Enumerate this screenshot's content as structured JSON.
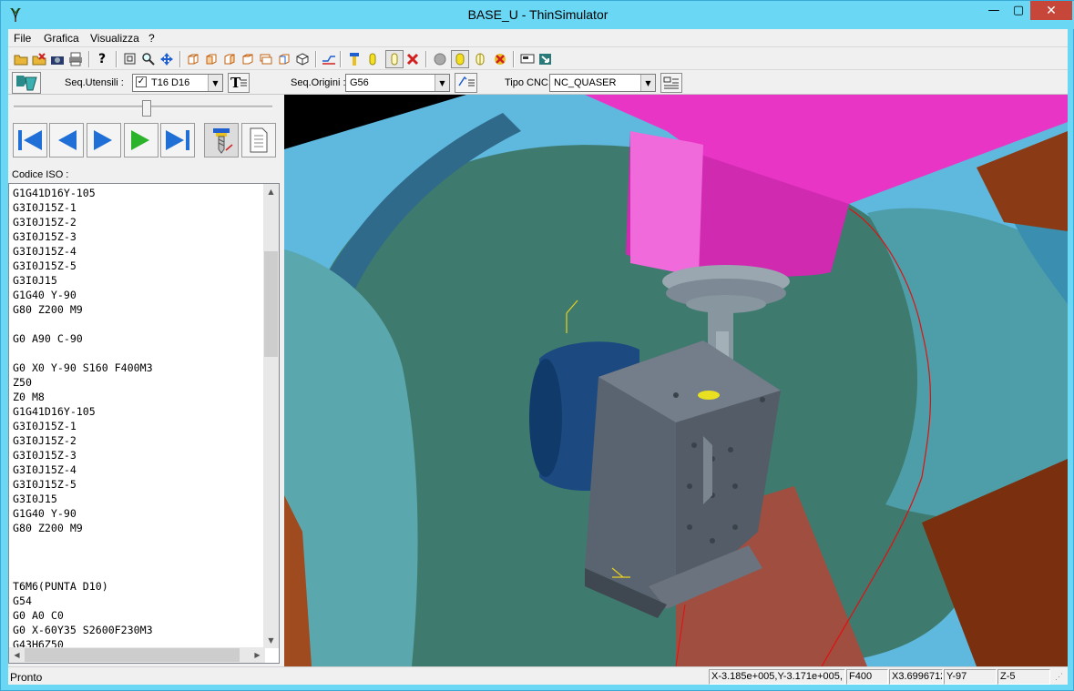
{
  "window": {
    "title": "BASE_U - ThinSimulator",
    "icon": "thinsimulator-app-icon",
    "controls": {
      "minimize": "—",
      "maximize": "▢",
      "close": "✕"
    }
  },
  "menu": {
    "file": "File",
    "grafica": "Grafica",
    "visualizza": "Visualizza",
    "help": "?"
  },
  "toolbar1": {
    "icons": [
      "open-folder-icon",
      "open-red-icon",
      "camera-icon",
      "print-icon",
      "help-icon",
      "zoom-window-icon",
      "zoom-icon",
      "pan-icon",
      "view-top-icon",
      "view-front-icon",
      "view-left-icon",
      "view-right-icon",
      "view-back-icon",
      "view-bottom-icon",
      "view-iso-icon",
      "path-icon",
      "tool-icon",
      "cylinder-icon",
      "cylinder-outline-icon",
      "cancel-icon",
      "gray-sphere-icon",
      "yellow-solid-icon",
      "yellow-wire-icon",
      "delete-icon",
      "display-icon",
      "export-icon"
    ]
  },
  "toolbar2": {
    "seq_utensili_label": "Seq.Utensili :",
    "tool_value": "T16 D16",
    "tool_checked": true,
    "seq_origini_label": "Seq.Origini :",
    "origin_value": "G56",
    "tipo_cnc_label": "Tipo CNC:",
    "cnc_value": "NC_QUASER"
  },
  "slider": {
    "position": 0.52
  },
  "codice_label": "Codice ISO :",
  "code_lines": [
    "G1G41D16Y-105",
    "G3I0J15Z-1",
    "G3I0J15Z-2",
    "G3I0J15Z-3",
    "G3I0J15Z-4",
    "G3I0J15Z-5",
    "G3I0J15",
    "G1G40 Y-90",
    "G80 Z200 M9",
    "",
    "G0 A90 C-90",
    "",
    "G0 X0 Y-90 S160 F400M3",
    "Z50",
    "Z0 M8",
    "G1G41D16Y-105",
    "G3I0J15Z-1",
    "G3I0J15Z-2",
    "G3I0J15Z-3",
    "G3I0J15Z-4",
    "G3I0J15Z-5",
    "G3I0J15",
    "G1G40 Y-90",
    "G80 Z200 M9",
    "",
    "",
    "",
    "T6M6(PUNTA D10)",
    "G54",
    "G0 A0 C0",
    "G0 X-60Y35 S2600F230M3",
    "G43H6Z50"
  ],
  "status": {
    "text": "Pronto",
    "coords": "X-3.185e+005,Y-3.171e+005,",
    "feed": "F400",
    "x": "X3.6996712",
    "y": "Y-97",
    "z": "Z-5"
  },
  "colors": {
    "titlebar": "#6ad7f5",
    "spindle": "#e935c6",
    "table_bg": "#3f7a6e",
    "part": "#5a6470",
    "accent_blue": "#1f6fd6",
    "play_green": "#2bb42b"
  }
}
